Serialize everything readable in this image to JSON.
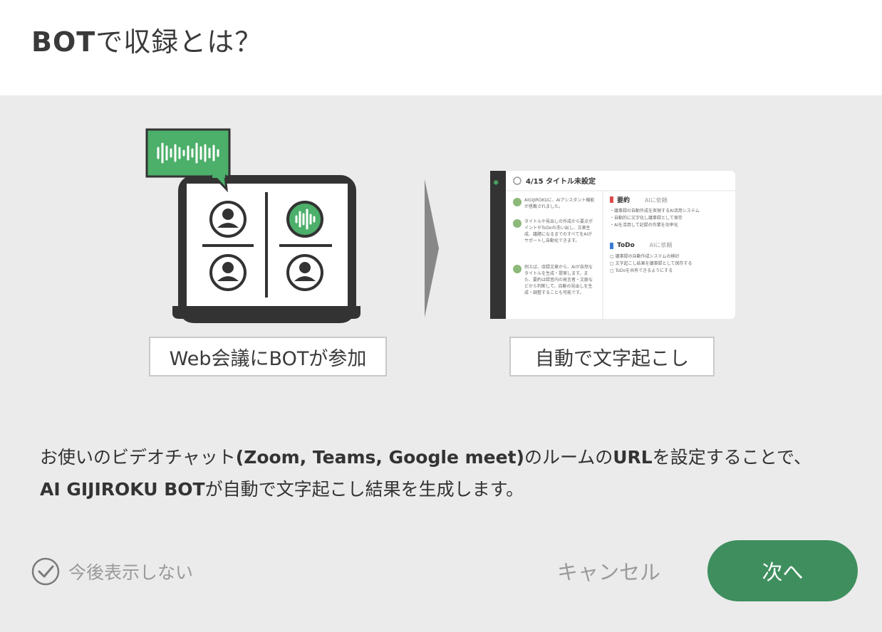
{
  "dialog": {
    "title_bold": "BOT",
    "title_rest": "で収録とは？"
  },
  "illustration": {
    "step1_caption": "Web会議にBOTが参加",
    "step2_caption": "自動で文字起こし",
    "doc_title": "4/15 タイトル未設定",
    "doc_section_summary": "要約",
    "doc_ai_request": "AIに依頼",
    "doc_section_todo": "ToDo",
    "doc_ai_request_2": "AIに依頼",
    "doc_chat": [
      "AIGIJIROKUに、AIアシスタント機能が搭載されました。",
      "タイトルや見出しの作成から要点ポイントやToDoの洗い出し、文章生成、議題になるまでのすべてをAIがサポートし自動化できます。",
      "例えば、収録文章から、AIが自然なタイトルを生成・提案します。また、要約は録音内の発言者・文脈などから判断して、自動の見出しを生成・調整することも可能です。"
    ],
    "doc_summary_items": [
      "・議事録の自動作成を実現するAI活用システム",
      "・自動的に文字化し議事録として保存",
      "・AIを活用して記録の作業を効率化"
    ],
    "doc_todo_items": [
      "□ 議事録の自動作成システムの検討",
      "□ 文字起こし結果を議事録として保存する",
      "□ ToDoを共有できるようにする"
    ]
  },
  "description": {
    "line1_a": "お使いのビデオチャット",
    "line1_b": "(Zoom, Teams, Google meet)",
    "line1_c": "のルームの",
    "line1_d": "URL",
    "line1_e": "を設定することで、",
    "line2_a": "AI GIJIROKU BOT",
    "line2_b": "が自動で文字起こし結果を生成します。"
  },
  "footer": {
    "dont_show_label": "今後表示しない",
    "cancel_label": "キャンセル",
    "next_label": "次へ"
  },
  "colors": {
    "accent": "#3f8f5e",
    "bot_green": "#4caf6a",
    "laptop_dark": "#333333"
  }
}
